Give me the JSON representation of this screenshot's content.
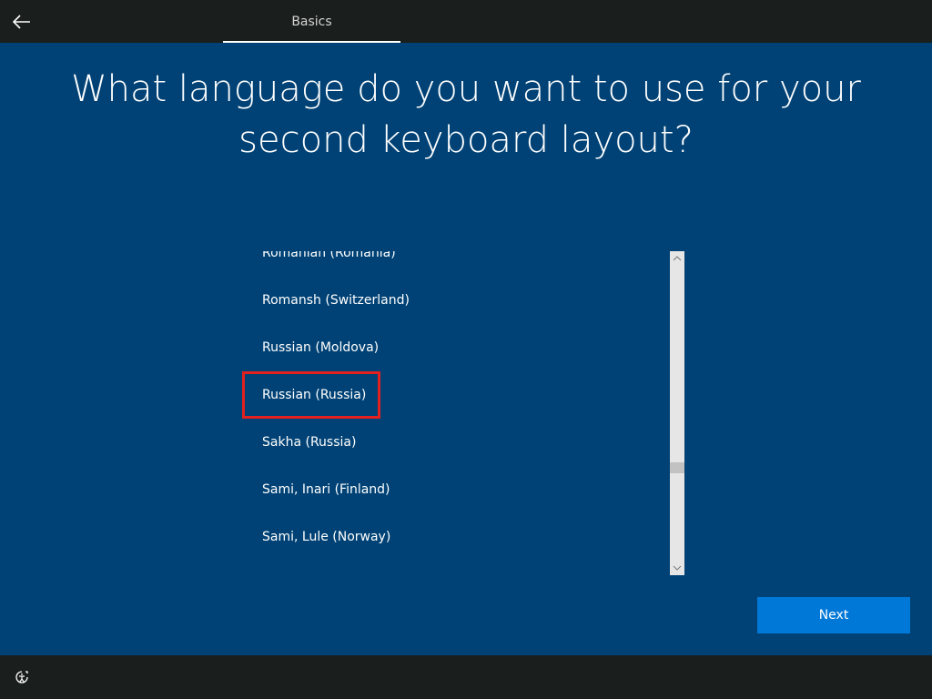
{
  "header": {
    "step_label": "Basics"
  },
  "main": {
    "heading": "What language do you want to use for your second keyboard layout?",
    "languages": [
      "Romanian (Romania)",
      "Romansh (Switzerland)",
      "Russian (Moldova)",
      "Russian (Russia)",
      "Sakha (Russia)",
      "Sami, Inari (Finland)",
      "Sami, Lule (Norway)"
    ],
    "selected_language": "Russian (Russia)",
    "next_label": "Next"
  },
  "icons": {
    "back": "back-arrow-icon",
    "accessibility": "ease-of-access-icon",
    "scroll_up": "chevron-up-icon",
    "scroll_down": "chevron-down-icon"
  },
  "colors": {
    "background": "#004275",
    "bars": "#1a1e1d",
    "next_button": "#0078d7",
    "selection_outline": "#e1201f"
  }
}
